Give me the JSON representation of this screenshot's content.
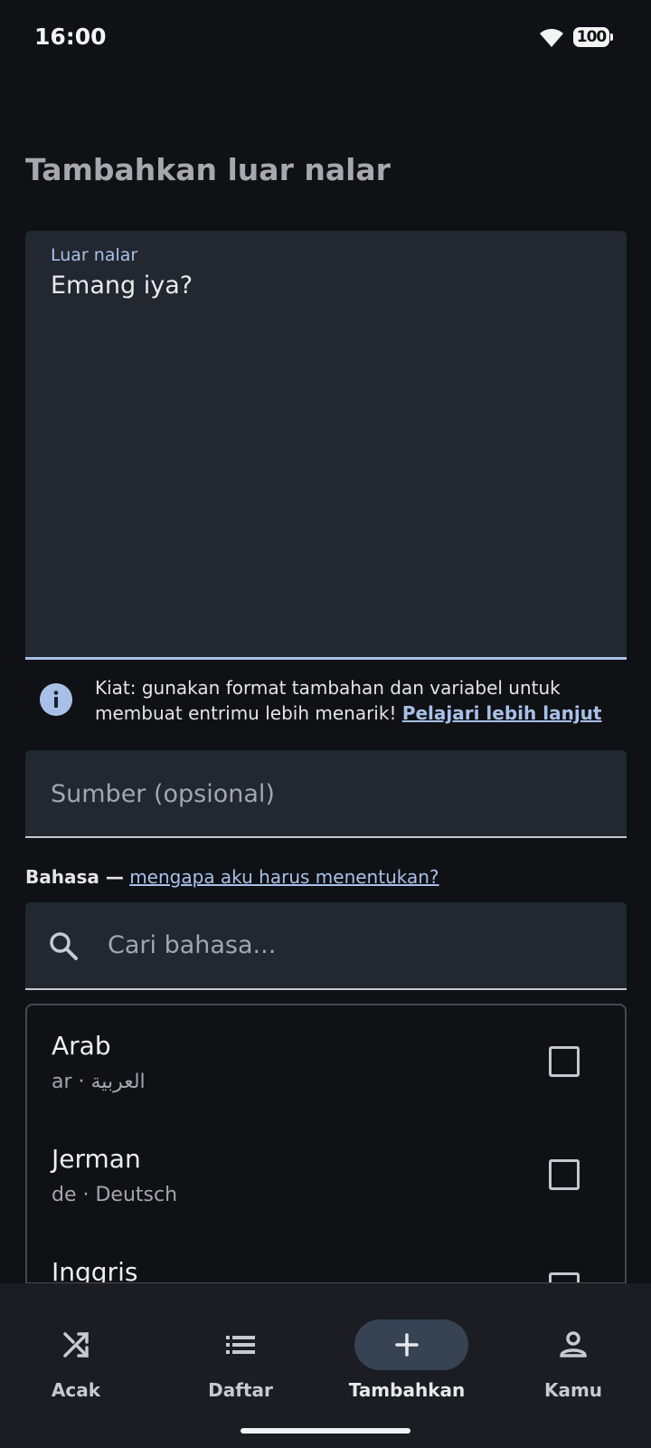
{
  "status": {
    "time": "16:00",
    "battery": "100"
  },
  "page": {
    "title": "Tambahkan luar nalar"
  },
  "content_field": {
    "label": "Luar nalar",
    "value": "Emang iya?"
  },
  "tip": {
    "text": "Kiat: gunakan format tambahan dan variabel untuk membuat entrimu lebih menarik! ",
    "link": "Pelajari lebih lanjut"
  },
  "source_field": {
    "placeholder": "Sumber (opsional)"
  },
  "language": {
    "heading": "Bahasa —",
    "why_link": "mengapa aku harus menentukan?",
    "search_placeholder": "Cari bahasa...",
    "items": [
      {
        "name": "Arab",
        "subtitle": "ar · العربية"
      },
      {
        "name": "Jerman",
        "subtitle": "de · Deutsch"
      },
      {
        "name": "Inggris",
        "subtitle": ""
      }
    ]
  },
  "nav": {
    "items": [
      {
        "label": "Acak",
        "icon": "shuffle-icon"
      },
      {
        "label": "Daftar",
        "icon": "list-icon"
      },
      {
        "label": "Tambahkan",
        "icon": "add-icon",
        "active": true
      },
      {
        "label": "Kamu",
        "icon": "person-icon"
      }
    ]
  },
  "colors": {
    "accent": "#a8c0e8",
    "background": "#0f1115",
    "surface": "#222730",
    "nav_active_pill": "#374253"
  }
}
